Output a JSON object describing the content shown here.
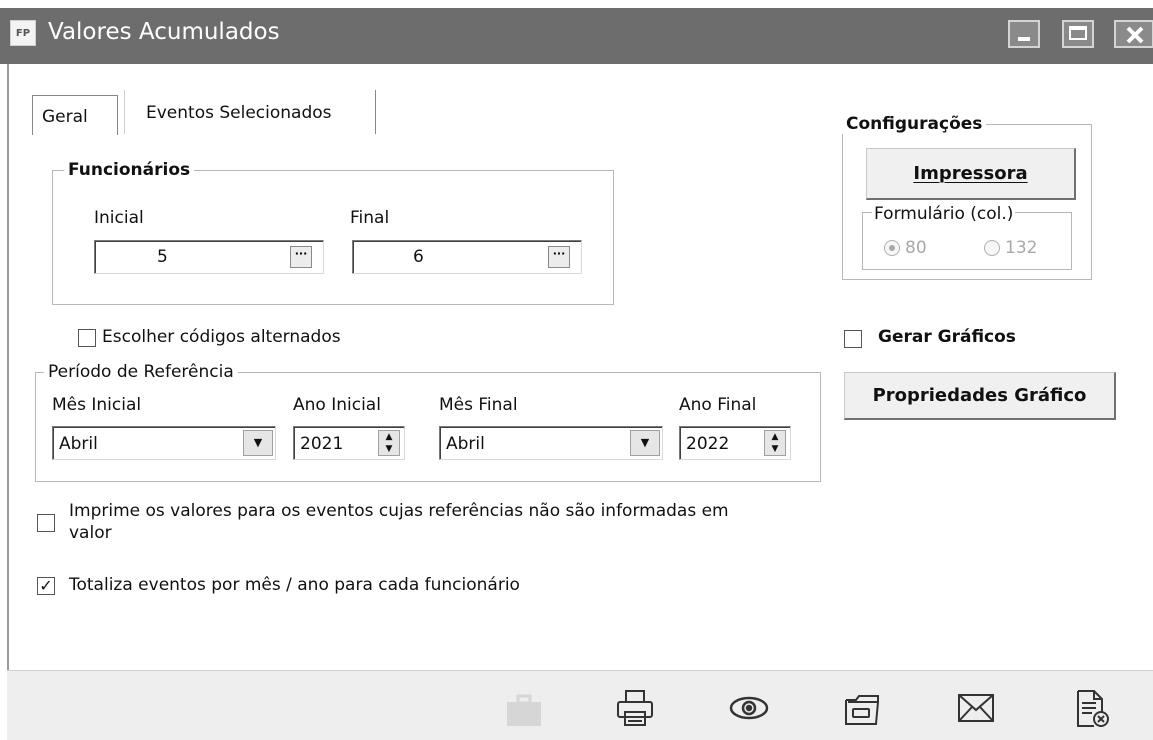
{
  "window": {
    "app_badge": "FP",
    "title": "Valores Acumulados"
  },
  "tabs": [
    {
      "label": "Geral"
    },
    {
      "label": "Eventos Selecionados"
    }
  ],
  "funcionarios": {
    "legend": "Funcionários",
    "inicial_label": "Inicial",
    "final_label": "Final",
    "inicial_value": "5",
    "final_value": "6"
  },
  "escolher": {
    "label": "Escolher códigos alternados",
    "checked": false
  },
  "periodo": {
    "legend": "Período de Referência",
    "mes_inicial_label": "Mês Inicial",
    "mes_inicial_value": "Abril",
    "ano_inicial_label": "Ano Inicial",
    "ano_inicial_value": "2021",
    "mes_final_label": "Mês Final",
    "mes_final_value": "Abril",
    "ano_final_label": "Ano Final",
    "ano_final_value": "2022"
  },
  "imprime": {
    "label_line1": "Imprime os valores para os eventos cujas referências não são informadas em",
    "label_line2": "valor",
    "checked": false
  },
  "totaliza": {
    "label": "Totaliza eventos por mês / ano para cada funcionário",
    "checked": true
  },
  "config": {
    "legend": "Configurações",
    "impressora_button": "Impressora",
    "formulario_legend": "Formulário (col.)",
    "option_80": "80",
    "option_132": "132",
    "selected": "80"
  },
  "gerar_graficos": {
    "label": "Gerar Gráficos",
    "checked": false
  },
  "propriedades_button": "Propriedades Gráfico",
  "toolbar": {
    "icons": [
      "briefcase-icon",
      "printer-icon",
      "eye-icon",
      "folder-icon",
      "envelope-icon",
      "close-document-icon"
    ]
  },
  "colors": {
    "titlebar": "#6d6d6d",
    "background": "#ffffff",
    "toolbar": "#eeeeee"
  }
}
